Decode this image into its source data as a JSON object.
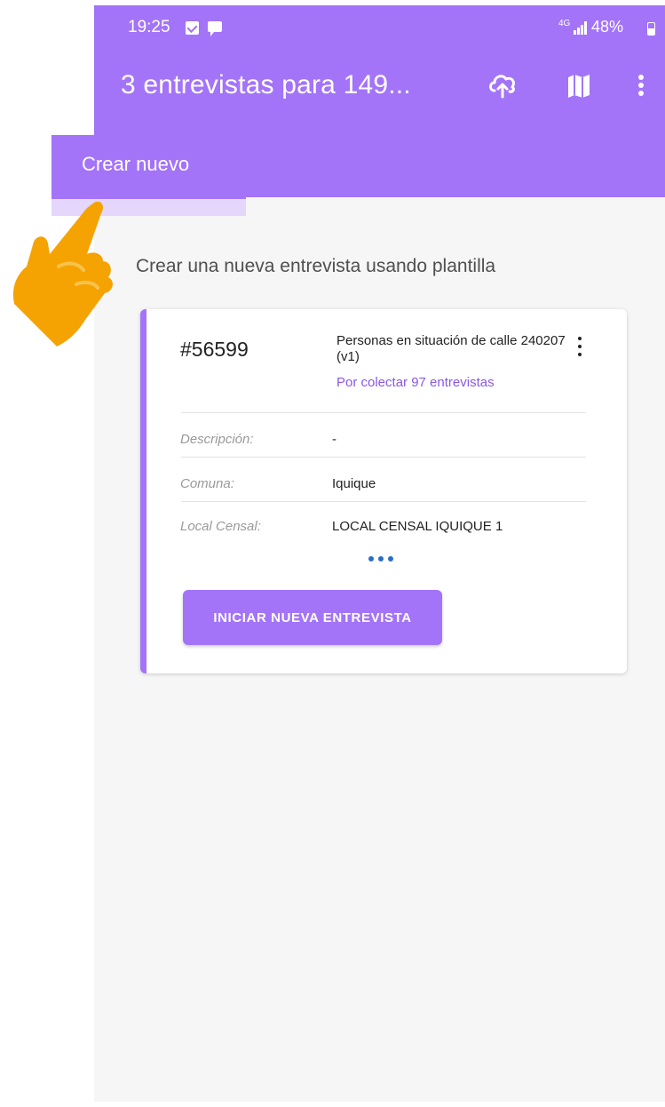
{
  "status_bar": {
    "time": "19:25",
    "network": "4G",
    "battery": "48%"
  },
  "app_bar": {
    "title": "3 entrevistas para 149...",
    "actions": [
      "cloud-upload-icon",
      "map-icon",
      "more-vert-icon"
    ]
  },
  "tab": {
    "label": "Crear nuevo"
  },
  "main": {
    "heading": "Crear una nueva entrevista usando plantilla",
    "card": {
      "id": "#56599",
      "template_name": "Personas en situación de calle 240207 (v1)",
      "status": "Por colectar 97 entrevistas",
      "fields": [
        {
          "label": "Descripción:",
          "value": "-"
        },
        {
          "label": "Comuna:",
          "value": "Iquique"
        },
        {
          "label": "Local Censal:",
          "value": "LOCAL CENSAL IQUIQUE 1"
        }
      ],
      "action_label": "INICIAR NUEVA ENTREVISTA"
    }
  },
  "colors": {
    "primary": "#a374f8",
    "accent_text": "#8a58e6",
    "pointer_hand": "#f5a302",
    "dots": "#2a6ec4"
  }
}
